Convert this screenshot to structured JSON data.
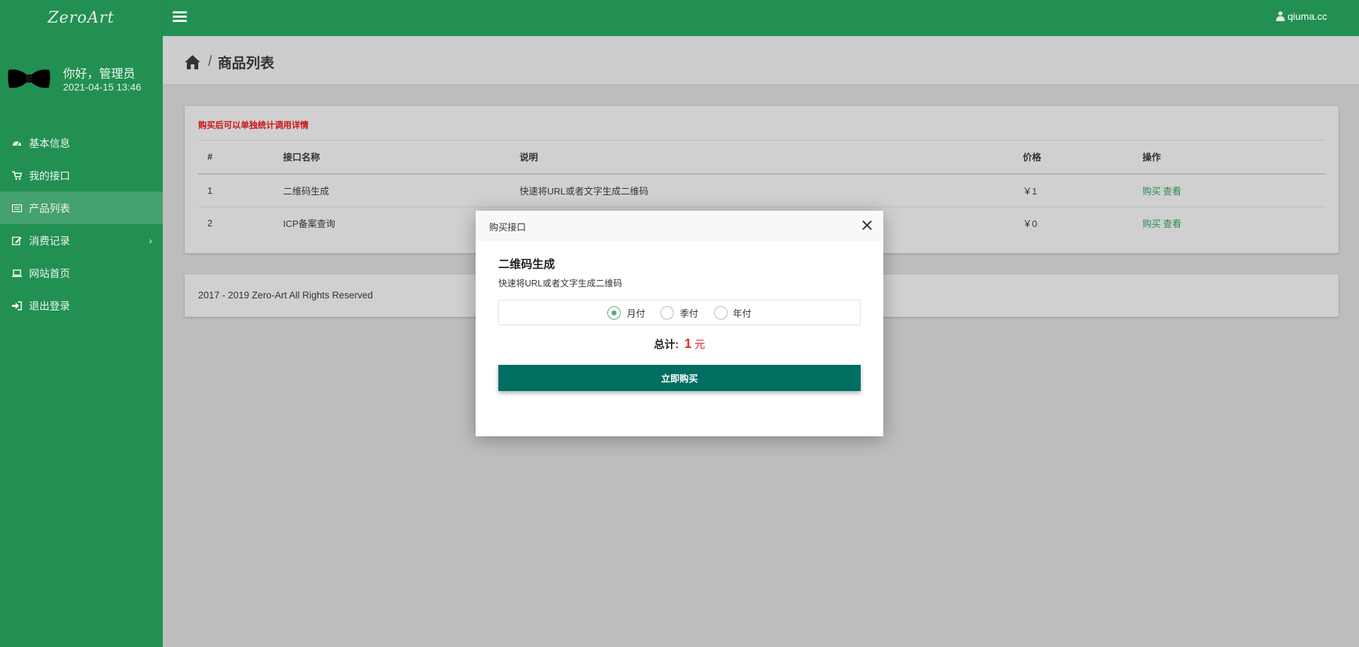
{
  "header": {
    "logo_text": "ZeroArt",
    "user_label": "qiuma.cc"
  },
  "sidebar": {
    "greeting": "你好，管理员",
    "datetime": "2021-04-15 13:46",
    "items": [
      {
        "label": "基本信息",
        "icon": "dashboard-icon"
      },
      {
        "label": "我的接口",
        "icon": "cart-icon"
      },
      {
        "label": "产品列表",
        "icon": "list-icon",
        "active": true
      },
      {
        "label": "消费记录",
        "icon": "edit-icon",
        "has_submenu": true
      },
      {
        "label": "网站首页",
        "icon": "laptop-icon"
      },
      {
        "label": "退出登录",
        "icon": "sign-out-icon"
      }
    ]
  },
  "breadcrumb": {
    "separator": "/",
    "current": "商品列表"
  },
  "card": {
    "notice": "购买后可以单独统计调用详情",
    "columns": [
      "#",
      "接口名称",
      "说明",
      "价格",
      "操作"
    ],
    "rows": [
      {
        "id": "1",
        "name": "二维码生成",
        "desc": "快速将URL或者文字生成二维码",
        "price": "￥1",
        "buy": "购买",
        "view": "查看"
      },
      {
        "id": "2",
        "name": "ICP备案查询",
        "desc": "",
        "price": "￥0",
        "buy": "购买",
        "view": "查看"
      }
    ]
  },
  "footer": {
    "text": "2017 - 2019 Zero-Art All Rights Reserved"
  },
  "modal": {
    "title": "购买接口",
    "product_name": "二维码生成",
    "product_desc": "快速将URL或者文字生成二维码",
    "plans": [
      {
        "label": "月付",
        "checked": true
      },
      {
        "label": "季付",
        "checked": false
      },
      {
        "label": "年付",
        "checked": false
      }
    ],
    "total_label": "总计:",
    "total_amount": "1",
    "total_unit": "元",
    "buy_button": "立即购买"
  },
  "colors": {
    "brand_green": "#229051",
    "buy_button": "#006f62",
    "price_red": "#b52222",
    "link_green": "#2a8a4e"
  }
}
